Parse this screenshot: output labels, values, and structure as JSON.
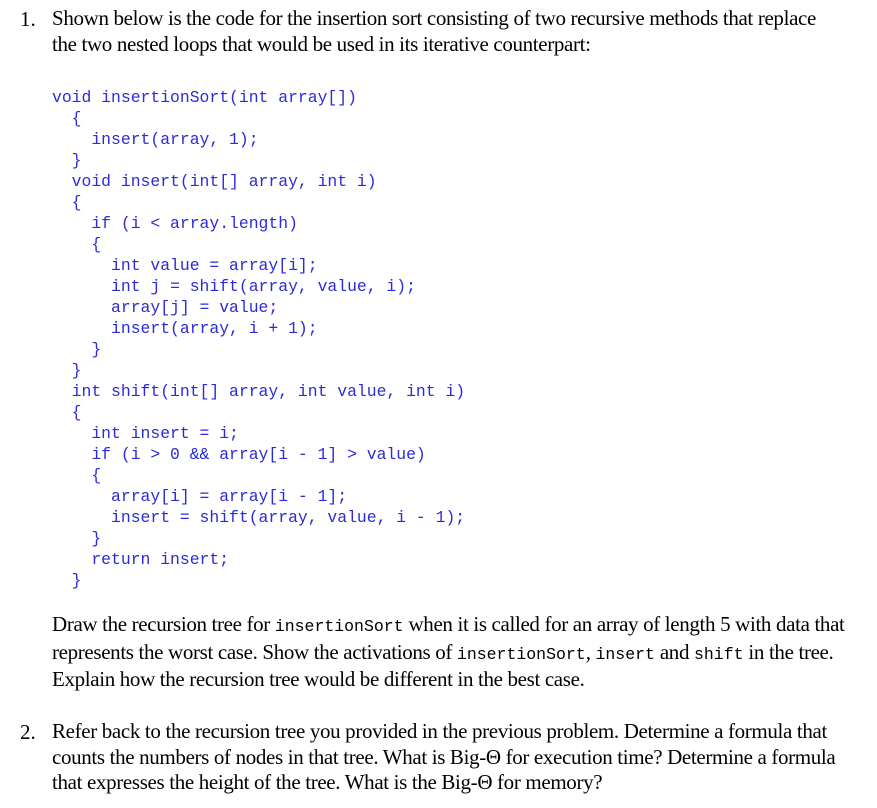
{
  "questions": [
    {
      "number": "1.",
      "intro": "Shown below is the code for the insertion sort consisting of two recursive methods that replace the two nested loops that would be used in its iterative counterpart:",
      "code_lines": [
        "void insertionSort(int array[])",
        "  {",
        "    insert(array, 1);",
        "  }",
        "  void insert(int[] array, int i)",
        "  {",
        "    if (i < array.length)",
        "    {",
        "      int value = array[i];",
        "      int j = shift(array, value, i);",
        "      array[j] = value;",
        "      insert(array, i + 1);",
        "    }",
        "  }",
        "  int shift(int[] array, int value, int i)",
        "  {",
        "    int insert = i;",
        "    if (i > 0 && array[i - 1] > value)",
        "    {",
        "      array[i] = array[i - 1];",
        "      insert = shift(array, value, i - 1);",
        "    }",
        "    return insert;",
        "  }"
      ],
      "prompt": {
        "t1": "Draw the recursion tree for ",
        "c1": "insertionSort",
        "t2": " when it is called for an array of length 5 with data that represents the worst case. Show the activations of ",
        "c2": "insertionSort",
        "t3": ", ",
        "c3": "insert",
        "t4": " and ",
        "c4": "shift",
        "t5": " in the tree. Explain how the recursion tree would be different in the best case."
      }
    },
    {
      "number": "2.",
      "text": "Refer back to the recursion tree you provided in the previous problem. Determine a formula that counts the numbers of nodes in that tree. What is Big-Θ for execution time? Determine a formula that expresses the height of the tree. What is the Big-Θ for memory?"
    }
  ],
  "colors": {
    "code": "#2b2bd8",
    "text": "#000000",
    "background": "#ffffff"
  }
}
